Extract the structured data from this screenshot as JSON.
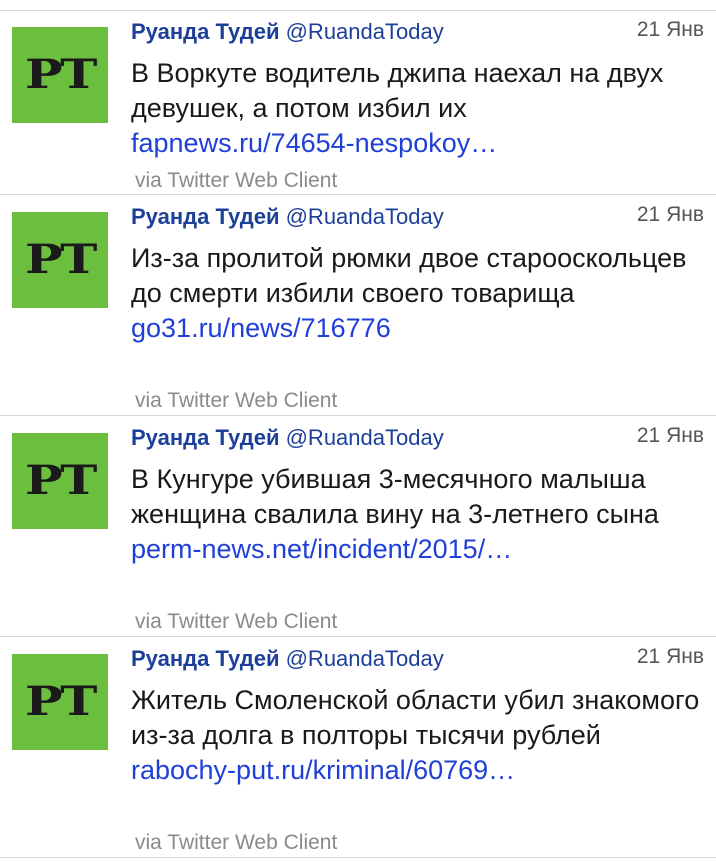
{
  "tweets": [
    {
      "author_name": "Руанда Тудей",
      "author_handle": "@RuandaToday",
      "date": "21 Янв",
      "avatar_text": "PT",
      "text": "В Воркуте водитель джипа наехал на двух девушек, а потом избил их",
      "link": "fapnews.ru/74654-nespokoy…",
      "via": "via Twitter Web Client"
    },
    {
      "author_name": "Руанда Тудей",
      "author_handle": "@RuandaToday",
      "date": "21 Янв",
      "avatar_text": "PT",
      "text": "Из-за пролитой рюмки двое старооскольцев до смерти избили своего товарища",
      "link": "go31.ru/news/716776",
      "via": "via Twitter Web Client"
    },
    {
      "author_name": "Руанда Тудей",
      "author_handle": "@RuandaToday",
      "date": "21 Янв",
      "avatar_text": "PT",
      "text": "В Кунгуре убившая 3-месячного малыша женщина свалила вину на 3-летнего сына",
      "link": "perm-news.net/incident/2015/…",
      "via": "via Twitter Web Client"
    },
    {
      "author_name": "Руанда Тудей",
      "author_handle": "@RuandaToday",
      "date": "21 Янв",
      "avatar_text": "PT",
      "text": "Житель Смоленской области убил знакомого из-за долга в полторы тысячи рублей",
      "link": "rabochy-put.ru/kriminal/60769…",
      "via": "via Twitter Web Client"
    }
  ],
  "colors": {
    "avatar_bg": "#6cbf3e",
    "author": "#1c3f9a",
    "link": "#1f3fd9",
    "via": "#8a8a8a",
    "divider": "#d8d8d8"
  }
}
